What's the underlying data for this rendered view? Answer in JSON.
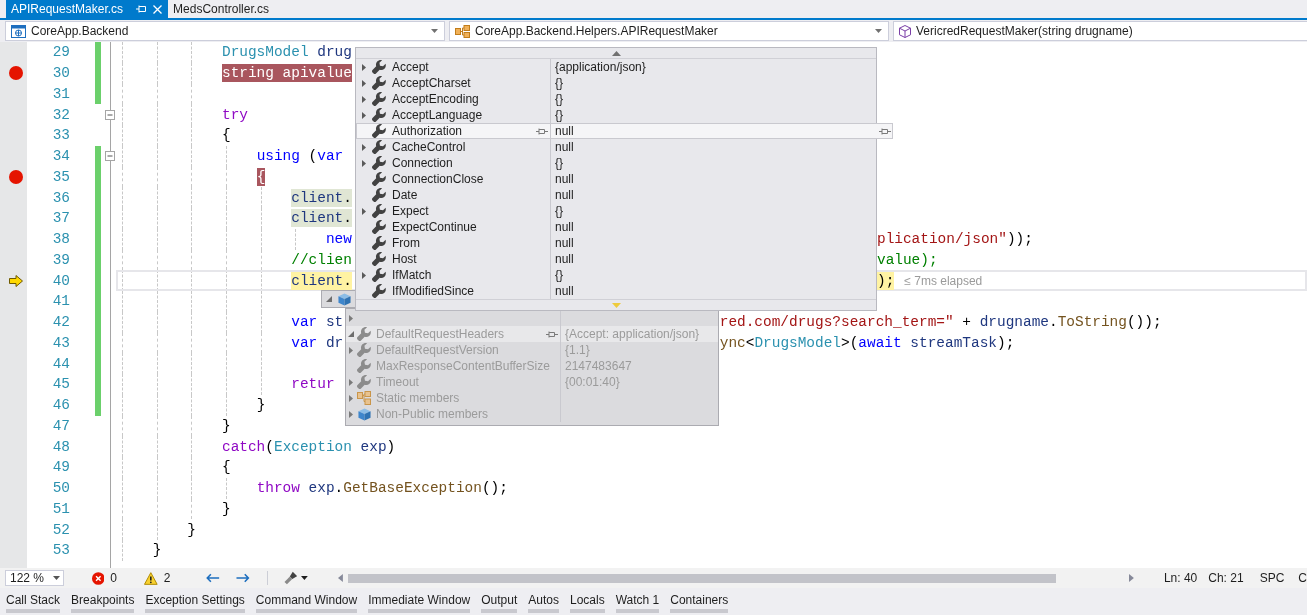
{
  "document_tabs": [
    {
      "label": "APIRequestMaker.cs",
      "selected": true
    },
    {
      "label": "MedsController.cs",
      "selected": false
    }
  ],
  "navigation_bar": [
    {
      "kind": "project",
      "text": "CoreApp.Backend"
    },
    {
      "kind": "type",
      "text": "CoreApp.Backend.Helpers.APIRequestMaker"
    },
    {
      "kind": "member",
      "text": "VericredRequestMaker(string drugname)"
    }
  ],
  "code_lines": [
    {
      "number": "29",
      "changed": true,
      "breakpoint": false,
      "current": false,
      "segments": [
        {
          "tokens": [
            {
              "text": "            DrugsModel",
              "kind": "type",
              "highlighted": false
            },
            {
              "text": " drug",
              "kind": "variable",
              "highlighted": false
            }
          ]
        }
      ]
    },
    {
      "number": "30",
      "changed": true,
      "breakpoint": true,
      "current": false,
      "segments": [
        {
          "tokens": [
            {
              "text": "            string",
              "kind": "keyword",
              "highlighted": true
            },
            {
              "text": " apivalue",
              "kind": "variable",
              "highlighted": true
            }
          ]
        }
      ]
    },
    {
      "number": "31",
      "changed": true,
      "breakpoint": false,
      "current": false
    },
    {
      "number": "32",
      "changed": false,
      "breakpoint": false,
      "current": false,
      "expanded": true,
      "segments": [
        {
          "tokens": [
            {
              "text": "            try",
              "kind": "control",
              "highlighted": false
            }
          ]
        }
      ]
    },
    {
      "number": "33",
      "changed": false,
      "breakpoint": false,
      "current": false,
      "segments": [
        {
          "tokens": [
            {
              "text": "            {",
              "kind": "plain",
              "highlighted": false
            }
          ]
        }
      ]
    },
    {
      "number": "34",
      "changed": true,
      "breakpoint": false,
      "current": false,
      "expanded": true,
      "segments": [
        {
          "tokens": [
            {
              "text": "                using",
              "kind": "keyword",
              "highlighted": false
            },
            {
              "text": " (",
              "kind": "plain",
              "highlighted": false
            },
            {
              "text": "var",
              "kind": "keyword",
              "highlighted": false
            }
          ]
        }
      ]
    },
    {
      "number": "35",
      "changed": true,
      "breakpoint": true,
      "current": false,
      "segments": [
        {
          "tokens": [
            {
              "text": "                {",
              "kind": "plain",
              "highlighted": true
            }
          ]
        }
      ]
    },
    {
      "number": "36",
      "changed": true,
      "breakpoint": false,
      "current": false,
      "segments": [
        {
          "tokens": [
            {
              "text": "                    client",
              "kind": "variable",
              "highlighted": true
            },
            {
              "text": ".",
              "kind": "plain",
              "highlighted": true
            }
          ]
        }
      ]
    },
    {
      "number": "37",
      "changed": true,
      "breakpoint": false,
      "current": false,
      "segments": [
        {
          "tokens": [
            {
              "text": "                    client",
              "kind": "variable",
              "highlighted": true
            },
            {
              "text": ".",
              "kind": "plain",
              "highlighted": true
            }
          ]
        }
      ]
    },
    {
      "number": "38",
      "changed": true,
      "breakpoint": false,
      "current": false,
      "segments": [
        {
          "tokens": [
            {
              "text": "                        new",
              "kind": "keyword",
              "highlighted": false
            }
          ]
        },
        {
          "tokens": [
            {
              "text": "plication/json\"",
              "kind": "string",
              "highlighted": false
            },
            {
              "text": "));",
              "kind": "plain",
              "highlighted": false
            }
          ]
        }
      ]
    },
    {
      "number": "39",
      "changed": true,
      "breakpoint": false,
      "current": false,
      "segments": [
        {
          "tokens": [
            {
              "text": "                    //clien",
              "kind": "comment",
              "highlighted": false
            }
          ]
        },
        {
          "tokens": [
            {
              "text": "value);",
              "kind": "comment",
              "highlighted": false
            }
          ]
        }
      ]
    },
    {
      "number": "40",
      "changed": true,
      "breakpoint": false,
      "current": true,
      "hint": "≤ 7ms elapsed",
      "segments": [
        {
          "tokens": [
            {
              "text": "                    client",
              "kind": "variable",
              "highlighted": true
            },
            {
              "text": ".",
              "kind": "plain",
              "highlighted": true
            }
          ]
        },
        {
          "tokens": [
            {
              "text": ");",
              "kind": "plain",
              "highlighted": true
            }
          ]
        }
      ]
    },
    {
      "number": "41",
      "changed": true,
      "breakpoint": false,
      "current": false
    },
    {
      "number": "42",
      "changed": true,
      "breakpoint": false,
      "current": false,
      "segments": [
        {
          "tokens": [
            {
              "text": "                    var",
              "kind": "keyword",
              "highlighted": false
            },
            {
              "text": " st",
              "kind": "variable",
              "highlighted": false
            }
          ]
        },
        {
          "tokens": [
            {
              "text": "red.com/drugs?search_term=\"",
              "kind": "string",
              "highlighted": false
            },
            {
              "text": " + ",
              "kind": "plain",
              "highlighted": false
            },
            {
              "text": "drugname",
              "kind": "variable",
              "highlighted": false
            },
            {
              "text": ".",
              "kind": "plain",
              "highlighted": false
            },
            {
              "text": "ToString",
              "kind": "method",
              "highlighted": false
            },
            {
              "text": "());",
              "kind": "plain",
              "highlighted": false
            }
          ]
        }
      ]
    },
    {
      "number": "43",
      "changed": true,
      "breakpoint": false,
      "current": false,
      "segments": [
        {
          "tokens": [
            {
              "text": "                    var",
              "kind": "keyword",
              "highlighted": false
            },
            {
              "text": " dr",
              "kind": "variable",
              "highlighted": false
            }
          ]
        },
        {
          "tokens": [
            {
              "text": "ync",
              "kind": "method",
              "highlighted": false
            },
            {
              "text": "<",
              "kind": "plain",
              "highlighted": false
            },
            {
              "text": "DrugsModel",
              "kind": "type",
              "highlighted": false
            },
            {
              "text": ">(",
              "kind": "plain",
              "highlighted": false
            },
            {
              "text": "await",
              "kind": "keyword",
              "highlighted": false
            },
            {
              "text": " streamTask",
              "kind": "variable",
              "highlighted": false
            },
            {
              "text": ");",
              "kind": "plain",
              "highlighted": false
            }
          ]
        }
      ]
    },
    {
      "number": "44",
      "changed": true,
      "breakpoint": false,
      "current": false
    },
    {
      "number": "45",
      "changed": true,
      "breakpoint": false,
      "current": false,
      "segments": [
        {
          "tokens": [
            {
              "text": "                    retur",
              "kind": "control",
              "highlighted": false
            }
          ]
        }
      ]
    },
    {
      "number": "46",
      "changed": true,
      "breakpoint": false,
      "current": false,
      "segments": [
        {
          "tokens": [
            {
              "text": "                }",
              "kind": "plain",
              "highlighted": false
            }
          ]
        }
      ]
    },
    {
      "number": "47",
      "changed": false,
      "breakpoint": false,
      "current": false,
      "segments": [
        {
          "tokens": [
            {
              "text": "            }",
              "kind": "plain",
              "highlighted": false
            }
          ]
        }
      ]
    },
    {
      "number": "48",
      "changed": false,
      "breakpoint": false,
      "current": false,
      "segments": [
        {
          "tokens": [
            {
              "text": "            catch",
              "kind": "control",
              "highlighted": false
            },
            {
              "text": "(",
              "kind": "plain",
              "highlighted": false
            },
            {
              "text": "Exception",
              "kind": "type",
              "highlighted": false
            },
            {
              "text": " exp",
              "kind": "variable",
              "highlighted": false
            },
            {
              "text": ")",
              "kind": "plain",
              "highlighted": false
            }
          ]
        }
      ]
    },
    {
      "number": "49",
      "changed": false,
      "breakpoint": false,
      "current": false,
      "segments": [
        {
          "tokens": [
            {
              "text": "            {",
              "kind": "plain",
              "highlighted": false
            }
          ]
        }
      ]
    },
    {
      "number": "50",
      "changed": false,
      "breakpoint": false,
      "current": false,
      "segments": [
        {
          "tokens": [
            {
              "text": "                throw",
              "kind": "control",
              "highlighted": false
            },
            {
              "text": " exp",
              "kind": "variable",
              "highlighted": false
            },
            {
              "text": ".",
              "kind": "plain",
              "highlighted": false
            },
            {
              "text": "GetBaseException",
              "kind": "method",
              "highlighted": false
            },
            {
              "text": "();",
              "kind": "plain",
              "highlighted": false
            }
          ]
        }
      ]
    },
    {
      "number": "51",
      "changed": false,
      "breakpoint": false,
      "current": false,
      "segments": [
        {
          "tokens": [
            {
              "text": "            }",
              "kind": "plain",
              "highlighted": false
            }
          ]
        }
      ]
    },
    {
      "number": "52",
      "changed": false,
      "breakpoint": false,
      "current": false,
      "segments": [
        {
          "tokens": [
            {
              "text": "        }",
              "kind": "plain",
              "highlighted": false
            }
          ]
        }
      ]
    },
    {
      "number": "53",
      "changed": false,
      "breakpoint": false,
      "current": false,
      "segments": [
        {
          "tokens": [
            {
              "text": "    }",
              "kind": "plain",
              "highlighted": false
            }
          ]
        }
      ]
    }
  ],
  "datatips": [
    {
      "dimmed": false,
      "scroll_arrows": true,
      "rows": [
        {
          "kind": "property",
          "name": "Accept",
          "value": "{application/json}",
          "expanded": false,
          "hovered": false
        },
        {
          "kind": "property",
          "name": "AcceptCharset",
          "value": "{}",
          "expanded": false,
          "hovered": false
        },
        {
          "kind": "property",
          "name": "AcceptEncoding",
          "value": "{}",
          "expanded": false,
          "hovered": false
        },
        {
          "kind": "property",
          "name": "AcceptLanguage",
          "value": "{}",
          "expanded": false,
          "hovered": false
        },
        {
          "kind": "property",
          "name": "Authorization",
          "value": "null",
          "hovered": true
        },
        {
          "kind": "property",
          "name": "CacheControl",
          "value": "null",
          "expanded": false,
          "hovered": false
        },
        {
          "kind": "property",
          "name": "Connection",
          "value": "{}",
          "expanded": false,
          "hovered": false
        },
        {
          "kind": "property",
          "name": "ConnectionClose",
          "value": "null",
          "hovered": false
        },
        {
          "kind": "property",
          "name": "Date",
          "value": "null",
          "hovered": false
        },
        {
          "kind": "property",
          "name": "Expect",
          "value": "{}",
          "expanded": false,
          "hovered": false
        },
        {
          "kind": "property",
          "name": "ExpectContinue",
          "value": "null",
          "hovered": false
        },
        {
          "kind": "property",
          "name": "From",
          "value": "null",
          "hovered": false
        },
        {
          "kind": "property",
          "name": "Host",
          "value": "null",
          "hovered": false
        },
        {
          "kind": "property",
          "name": "IfMatch",
          "value": "{}",
          "expanded": false,
          "hovered": false
        },
        {
          "kind": "property",
          "name": "IfModifiedSince",
          "value": "null",
          "hovered": false
        }
      ]
    },
    {
      "dimmed": true,
      "rows": [
        {
          "kind": "object",
          "expanded": true
        }
      ]
    },
    {
      "dimmed": true,
      "rows": [
        {
          "expanded": false,
          "hovered": false
        },
        {
          "kind": "property",
          "name": "DefaultRequestHeaders",
          "value": "{Accept: application/json}",
          "expanded": true,
          "hovered": true
        },
        {
          "kind": "property",
          "name": "DefaultRequestVersion",
          "value": "{1.1}",
          "expanded": false,
          "hovered": false
        },
        {
          "kind": "property",
          "name": "MaxResponseContentBufferSize",
          "value": "2147483647",
          "hovered": false
        },
        {
          "kind": "property",
          "name": "Timeout",
          "value": "{00:01:40}",
          "expanded": false,
          "hovered": false
        },
        {
          "kind": "static",
          "name": "Static members",
          "expanded": false,
          "hovered": false
        },
        {
          "kind": "object",
          "name": "Non-Public members",
          "expanded": false,
          "hovered": false
        }
      ]
    }
  ],
  "status_bar": {
    "zoom": "122 %",
    "errors": "0",
    "warnings": "2",
    "line": "Ln: 40",
    "column": "Ch: 21",
    "indentation": "SPC",
    "line_ending": "C"
  },
  "tool_window_tabs": [
    "Call Stack",
    "Breakpoints",
    "Exception Settings",
    "Command Window",
    "Immediate Window",
    "Output",
    "Autos",
    "Locals",
    "Watch 1",
    "Containers"
  ]
}
